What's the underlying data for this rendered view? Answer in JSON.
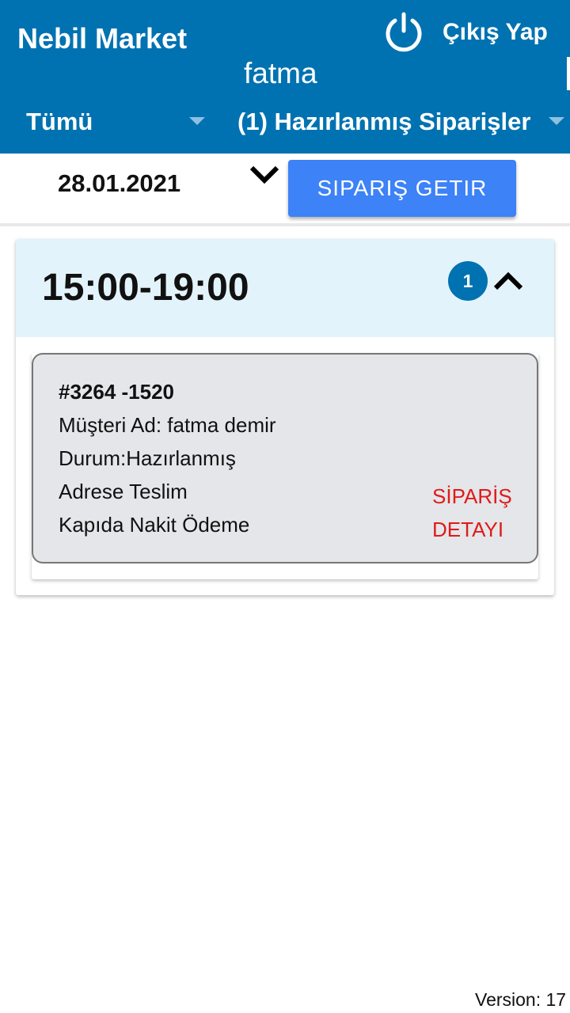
{
  "header": {
    "title": "Nebil Market",
    "logout_label": "Çıkış Yap",
    "user_name": "fatma",
    "category_filter": "Tümü",
    "status_filter": "(1) Hazırlanmış Siparişler"
  },
  "filter": {
    "date": "28.01.2021",
    "fetch_button": "SIPARIŞ GETIR"
  },
  "time_slot": {
    "label": "15:00-19:00",
    "count": "1"
  },
  "order": {
    "number": "#3264 -1520",
    "customer": "Müşteri Ad: fatma demir",
    "status": "Durum:Hazırlanmış",
    "delivery": "Adrese Teslim",
    "payment": "Kapıda Nakit Ödeme",
    "detail_link": "SİPARİŞ DETAYI"
  },
  "footer": {
    "version": "Version: 17"
  },
  "colors": {
    "header_bg": "#0072b1",
    "button_bg": "#3d82f6",
    "group_header_bg": "#e3f3fc",
    "order_card_bg": "#e4e6e9",
    "detail_link": "#e01a1a"
  }
}
